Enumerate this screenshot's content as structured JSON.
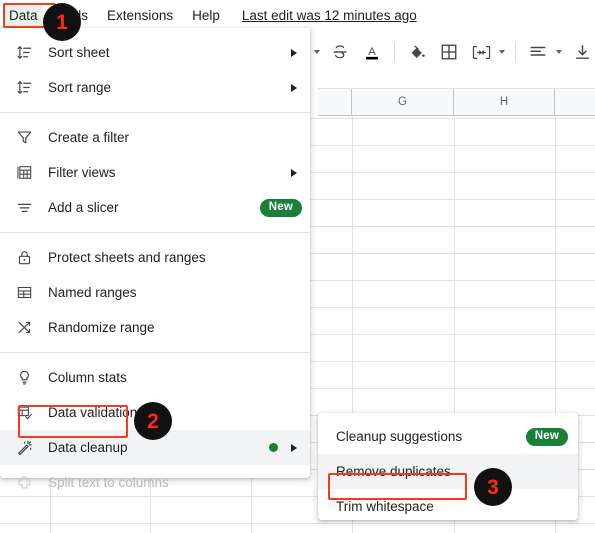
{
  "menubar": {
    "items": [
      {
        "label": "Data",
        "active": true
      },
      {
        "label": "Tools",
        "active": false
      },
      {
        "label": "Extensions",
        "active": false
      },
      {
        "label": "Help",
        "active": false
      }
    ],
    "edit_status": "Last edit was 12 minutes ago"
  },
  "toolbar": {
    "icons": [
      {
        "name": "font-size-caret",
        "glyph": ""
      },
      {
        "name": "text-format-caret",
        "glyph": ""
      },
      {
        "name": "strikethrough-icon",
        "glyph": "S"
      },
      {
        "name": "text-color-icon",
        "glyph": "A"
      },
      {
        "name": "fill-color-icon",
        "glyph": ""
      },
      {
        "name": "borders-icon",
        "glyph": ""
      },
      {
        "name": "merge-cells-icon",
        "glyph": ""
      },
      {
        "name": "horizontal-align-icon",
        "glyph": ""
      },
      {
        "name": "vertical-align-icon",
        "glyph": ""
      }
    ]
  },
  "grid": {
    "column_headers": [
      "",
      "G",
      "H",
      ""
    ]
  },
  "data_menu": {
    "groups": [
      {
        "items": [
          {
            "label": "Sort sheet",
            "icon": "sort-icon",
            "arrow": true,
            "badge": null,
            "dot": false,
            "disabled": false,
            "highlighted": false
          },
          {
            "label": "Sort range",
            "icon": "sort-icon",
            "arrow": true,
            "badge": null,
            "dot": false,
            "disabled": false,
            "highlighted": false
          }
        ]
      },
      {
        "items": [
          {
            "label": "Create a filter",
            "icon": "filter-icon",
            "arrow": false,
            "badge": null,
            "dot": false,
            "disabled": false,
            "highlighted": false
          },
          {
            "label": "Filter views",
            "icon": "filter-views-icon",
            "arrow": true,
            "badge": null,
            "dot": false,
            "disabled": false,
            "highlighted": false
          },
          {
            "label": "Add a slicer",
            "icon": "slicer-icon",
            "arrow": false,
            "badge": "New",
            "dot": false,
            "disabled": false,
            "highlighted": false
          }
        ]
      },
      {
        "items": [
          {
            "label": "Protect sheets and ranges",
            "icon": "lock-icon",
            "arrow": false,
            "badge": null,
            "dot": false,
            "disabled": false,
            "highlighted": false
          },
          {
            "label": "Named ranges",
            "icon": "named-ranges-icon",
            "arrow": false,
            "badge": null,
            "dot": false,
            "disabled": false,
            "highlighted": false
          },
          {
            "label": "Randomize range",
            "icon": "randomize-icon",
            "arrow": false,
            "badge": null,
            "dot": false,
            "disabled": false,
            "highlighted": false
          }
        ]
      },
      {
        "items": [
          {
            "label": "Column stats",
            "icon": "lightbulb-icon",
            "arrow": false,
            "badge": null,
            "dot": false,
            "disabled": false,
            "highlighted": false
          },
          {
            "label": "Data validation",
            "icon": "data-validation-icon",
            "arrow": false,
            "badge": null,
            "dot": false,
            "disabled": false,
            "highlighted": false
          },
          {
            "label": "Data cleanup",
            "icon": "magic-wand-icon",
            "arrow": true,
            "badge": null,
            "dot": true,
            "disabled": false,
            "highlighted": true
          },
          {
            "label": "Split text to columns",
            "icon": "split-text-icon",
            "arrow": false,
            "badge": null,
            "dot": false,
            "disabled": true,
            "highlighted": false
          }
        ]
      }
    ]
  },
  "data_cleanup_submenu": {
    "items": [
      {
        "label": "Cleanup suggestions",
        "badge": "New",
        "highlighted": false
      },
      {
        "label": "Remove duplicates",
        "badge": null,
        "highlighted": true
      },
      {
        "label": "Trim whitespace",
        "badge": null,
        "highlighted": false
      }
    ]
  },
  "annotations": {
    "badges": [
      {
        "number": "1",
        "target": "data-menubar-item"
      },
      {
        "number": "2",
        "target": "data-cleanup-menu-item"
      },
      {
        "number": "3",
        "target": "remove-duplicates-submenu-item"
      }
    ],
    "highlight_color": "#f03c20",
    "badge_bg": "#111111",
    "badge_fg": "#ff2a10",
    "new_badge_color": "#188038"
  }
}
